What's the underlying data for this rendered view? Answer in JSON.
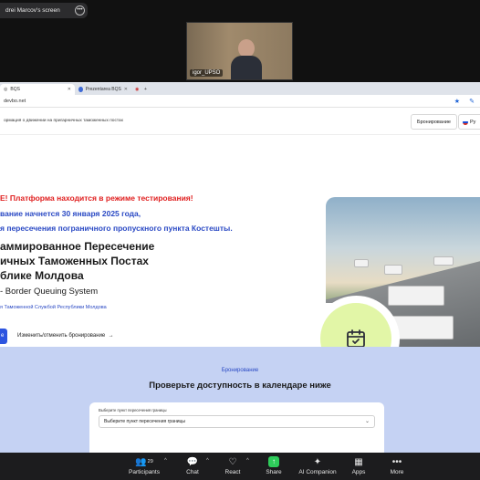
{
  "zoom": {
    "share_label": "drei Marcov's screen",
    "participant_name": "igor_UPSO",
    "toolbar": {
      "participants_label": "Participants",
      "participants_count": "29",
      "chat_label": "Chat",
      "react_label": "React",
      "share_label": "Share",
      "ai_label": "AI Companion",
      "apps_label": "Apps",
      "more_label": "More"
    }
  },
  "browser": {
    "tabs": [
      "BQS",
      "Prezentarea BQS"
    ],
    "url": "devbo.net"
  },
  "site": {
    "tagline": "ормация о движении на пригарничных таможенных постах",
    "book_button": "Бронирование",
    "lang_button": "Ру",
    "warning_line1": "E! Платформа находится в режиме тестирования!",
    "warning_line2": "вание начнется 30 января 2025 года,",
    "warning_line3": "я пересечения пограничного пропускного пункта Костешты.",
    "heading_line1": "аммированное Пересечение",
    "heading_line2": "ичных Таможенных Постах",
    "heading_line3": "блике Молдова",
    "subtitle": "- Border Queuing System",
    "support": "я Таможенной Службой Республики Молдова",
    "cta_label": "е",
    "manage_link": "Изменить/отменить бронирование",
    "booking_section": {
      "label": "Бронирование",
      "title": "Проверьте доступность в календаре ниже",
      "select_label": "Выберите пункт пересечения границы",
      "select_value": "Выберите пункт пересечения границы"
    }
  },
  "colors": {
    "warning_red": "#e02020",
    "accent_blue": "#2a49c4",
    "booking_bg": "#c5d2f3",
    "circle_green": "#e2f6a7"
  }
}
